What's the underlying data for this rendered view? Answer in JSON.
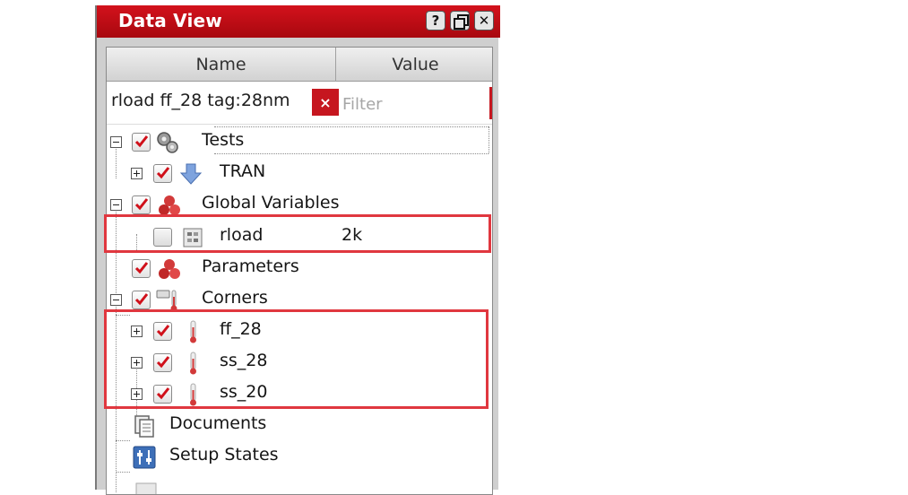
{
  "window": {
    "title": "Data View",
    "buttons": {
      "help": "?",
      "close": "✕"
    }
  },
  "columns": {
    "name": "Name",
    "value": "Value"
  },
  "filter": {
    "query": "rload ff_28 tag:28nm",
    "clear": "×",
    "placeholder": "Filter"
  },
  "tree": {
    "tests": {
      "label": "Tests",
      "checked": true,
      "expanded": true,
      "icon": "gears-icon",
      "children": {
        "tran": {
          "label": "TRAN",
          "checked": true,
          "icon": "down-arrow-icon"
        }
      }
    },
    "global_variables": {
      "label": "Global Variables",
      "checked": true,
      "expanded": true,
      "icon": "red-spheres-icon",
      "children": {
        "rload": {
          "label": "rload",
          "value": "2k",
          "checked": false,
          "icon": "variable-icon"
        }
      }
    },
    "parameters": {
      "label": "Parameters",
      "checked": true,
      "icon": "red-spheres-icon"
    },
    "corners": {
      "label": "Corners",
      "checked": true,
      "expanded": true,
      "icon": "thermometer-icon",
      "children": {
        "ff_28": {
          "label": "ff_28",
          "checked": true,
          "icon": "thermometer-icon"
        },
        "ss_28": {
          "label": "ss_28",
          "checked": true,
          "icon": "thermometer-icon"
        },
        "ss_20": {
          "label": "ss_20",
          "checked": true,
          "icon": "thermometer-icon"
        }
      }
    },
    "documents": {
      "label": "Documents",
      "icon": "document-icon"
    },
    "setup_states": {
      "label": "Setup States",
      "icon": "setup-icon"
    }
  },
  "colors": {
    "title_bar": "#c8101a",
    "highlight": "#e0373f",
    "check": "#d0101a"
  }
}
